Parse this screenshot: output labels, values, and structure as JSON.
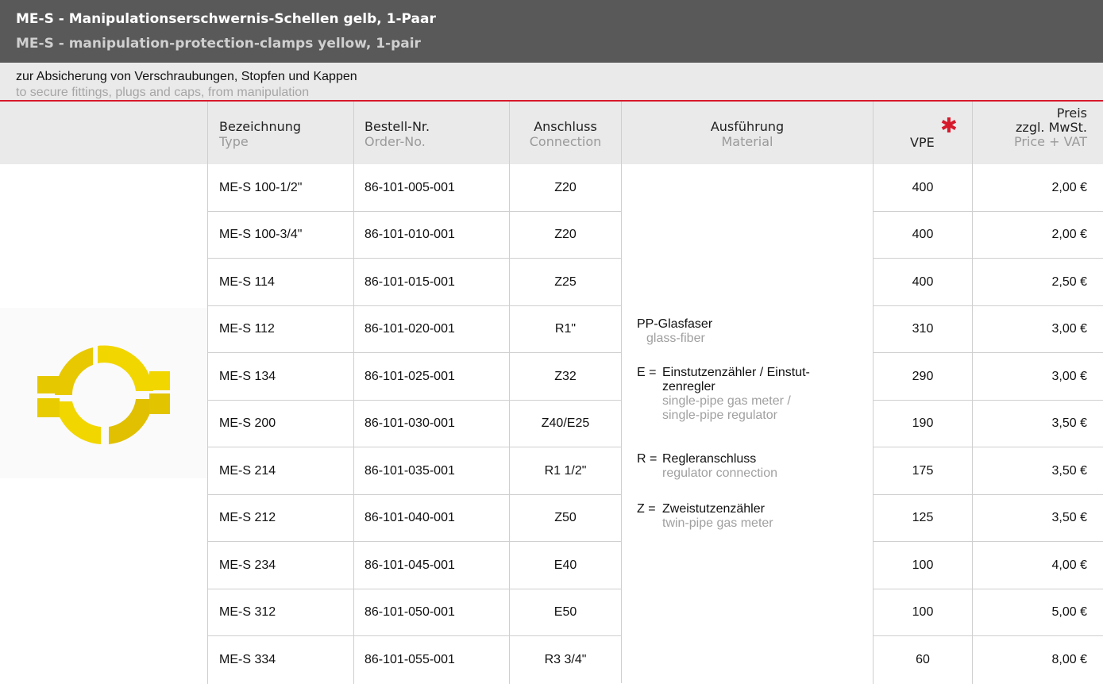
{
  "title": {
    "de": "ME-S - Manipulationserschwernis-Schellen gelb, 1-Paar",
    "en": "ME-S - manipulation-protection-clamps yellow, 1-pair"
  },
  "subtitle": {
    "de": "zur Absicherung von Verschraubungen, Stopfen und Kappen",
    "en": "to secure fittings, plugs and caps, from manipulation"
  },
  "header": {
    "type_de": "Bezeichnung",
    "type_en": "Type",
    "order_de": "Bestell-Nr.",
    "order_en": "Order-No.",
    "conn_de": "Anschluss",
    "conn_en": "Connection",
    "mat_de": "Ausführung",
    "mat_en": "Material",
    "vpe": "VPE",
    "star": "✱",
    "price_de1": "Preis",
    "price_de2": "zzgl. MwSt.",
    "price_en": "Price + VAT"
  },
  "material": {
    "line1": "PP-Glasfaser",
    "line1_en": "glass-fiber",
    "e_key": "E =",
    "e_de": "Einstutzenzähler / Einstut-zenregler",
    "e_en1": "single-pipe gas meter /",
    "e_en2": "single-pipe regulator",
    "r_key": "R =",
    "r_de": "Regleranschluss",
    "r_en": "regulator connection",
    "z_key": "Z =",
    "z_de": "Zweistutzenzähler",
    "z_en": "twin-pipe gas meter"
  },
  "colors": {
    "title_bg": "#595959",
    "sub_bg": "#eaeaea",
    "accent": "#d7192c",
    "product": "#f2d600"
  },
  "icons": {
    "product_image": "yellow-clamp-pair-image"
  },
  "rows": [
    {
      "type": "ME-S 100-1/2\"",
      "order": "86-101-005-001",
      "conn": "Z20",
      "vpe": "400",
      "price": "2,00 €"
    },
    {
      "type": "ME-S 100-3/4\"",
      "order": "86-101-010-001",
      "conn": "Z20",
      "vpe": "400",
      "price": "2,00 €"
    },
    {
      "type": "ME-S 114",
      "order": "86-101-015-001",
      "conn": "Z25",
      "vpe": "400",
      "price": "2,50 €"
    },
    {
      "type": "ME-S 112",
      "order": "86-101-020-001",
      "conn": "R1\"",
      "vpe": "310",
      "price": "3,00 €"
    },
    {
      "type": "ME-S 134",
      "order": "86-101-025-001",
      "conn": "Z32",
      "vpe": "290",
      "price": "3,00 €"
    },
    {
      "type": "ME-S 200",
      "order": "86-101-030-001",
      "conn": "Z40/E25",
      "vpe": "190",
      "price": "3,50 €"
    },
    {
      "type": "ME-S 214",
      "order": "86-101-035-001",
      "conn": "R1 1/2\"",
      "vpe": "175",
      "price": "3,50 €"
    },
    {
      "type": "ME-S 212",
      "order": "86-101-040-001",
      "conn": "Z50",
      "vpe": "125",
      "price": "3,50 €"
    },
    {
      "type": "ME-S 234",
      "order": "86-101-045-001",
      "conn": "E40",
      "vpe": "100",
      "price": "4,00 €"
    },
    {
      "type": "ME-S 312",
      "order": "86-101-050-001",
      "conn": "E50",
      "vpe": "100",
      "price": "5,00 €"
    },
    {
      "type": "ME-S 334",
      "order": "86-101-055-001",
      "conn": "R3 3/4\"",
      "vpe": "60",
      "price": "8,00 €"
    }
  ]
}
